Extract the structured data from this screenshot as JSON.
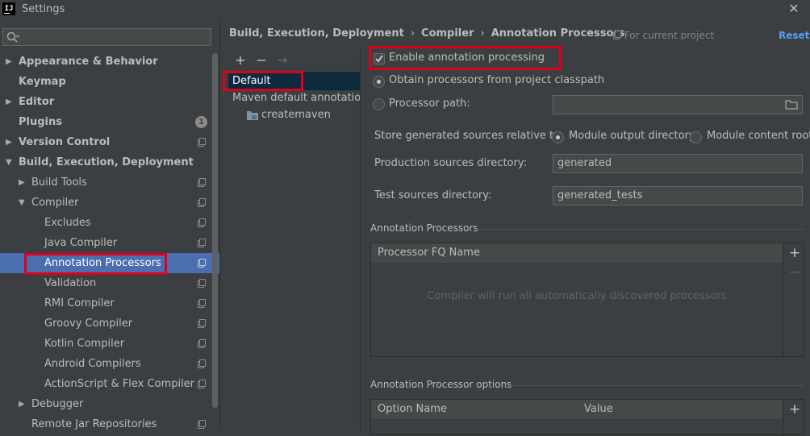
{
  "window": {
    "title": "Settings",
    "app_icon": "IJ"
  },
  "search": {
    "placeholder": "",
    "value": ""
  },
  "tree": {
    "items": [
      {
        "label": "Appearance & Behavior"
      },
      {
        "label": "Keymap"
      },
      {
        "label": "Editor"
      },
      {
        "label": "Plugins",
        "badge": "1"
      },
      {
        "label": "Version Control"
      },
      {
        "label": "Build, Execution, Deployment"
      },
      {
        "label": "Build Tools"
      },
      {
        "label": "Compiler"
      },
      {
        "label": "Excludes"
      },
      {
        "label": "Java Compiler"
      },
      {
        "label": "Annotation Processors"
      },
      {
        "label": "Validation"
      },
      {
        "label": "RMI Compiler"
      },
      {
        "label": "Groovy Compiler"
      },
      {
        "label": "Kotlin Compiler"
      },
      {
        "label": "Android Compilers"
      },
      {
        "label": "ActionScript & Flex Compiler"
      },
      {
        "label": "Debugger"
      },
      {
        "label": "Remote Jar Repositories"
      }
    ]
  },
  "breadcrumb": {
    "part1": "Build, Execution, Deployment",
    "part2": "Compiler",
    "part3": "Annotation Processors",
    "separator": "›"
  },
  "header": {
    "scope": "For current project",
    "reset": "Reset"
  },
  "profiles": {
    "add": "+",
    "remove": "−",
    "move": "→",
    "items": [
      {
        "label": "Default"
      },
      {
        "label": "Maven default annotation processors profile"
      },
      {
        "label": "createmaven"
      }
    ]
  },
  "settings": {
    "enable_label": "Enable annotation processing",
    "enable_checked": true,
    "obtain_label": "Obtain processors from project classpath",
    "processor_path_label": "Processor path:",
    "processor_path_value": "",
    "store_label": "Store generated sources relative to:",
    "module_output_label": "Module output directory",
    "module_content_label": "Module content root",
    "production_label": "Production sources directory:",
    "production_value": "generated",
    "test_label": "Test sources directory:",
    "test_value": "generated_tests"
  },
  "annotation_processors": {
    "title": "Annotation Processors",
    "column": "Processor FQ Name",
    "empty_text": "Compiler will run all automatically discovered processors",
    "add": "+",
    "remove": "−"
  },
  "processor_options": {
    "title": "Annotation Processor options",
    "columns": [
      "Option Name",
      "Value"
    ],
    "add": "+"
  },
  "colors": {
    "background": "#3c3f41",
    "selection": "#4b6eaf",
    "highlight": "#e0001a",
    "link": "#589df6"
  }
}
